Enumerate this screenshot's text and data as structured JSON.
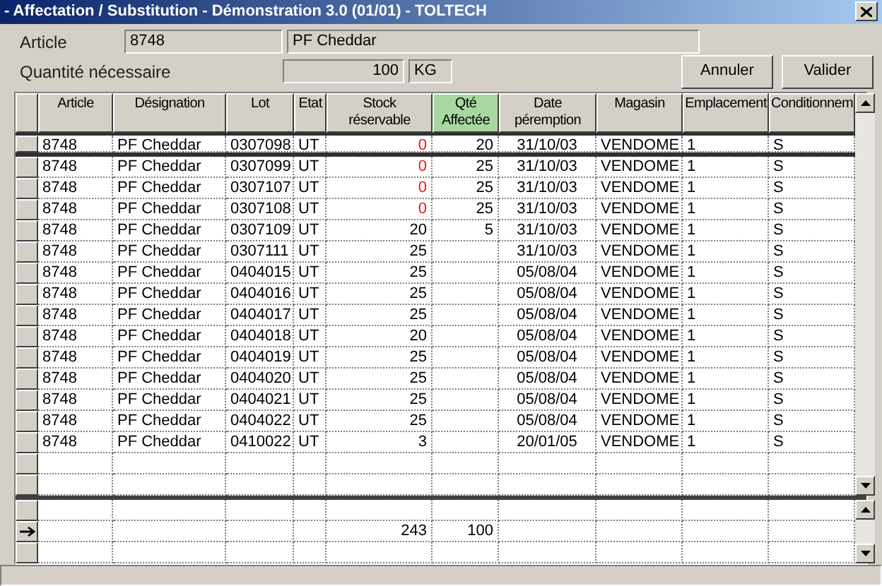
{
  "window": {
    "title": "- Affectation / Substitution - Démonstration 3.0 (01/01) - TOLTECH"
  },
  "article": {
    "label": "Article",
    "code": "8748",
    "name": "PF Cheddar"
  },
  "quantity": {
    "label": "Quantité nécessaire",
    "value": "100",
    "unit": "KG"
  },
  "buttons": [
    "Annuler",
    "Valider"
  ],
  "table": {
    "columns": [
      {
        "label": "Article",
        "highlighted": false
      },
      {
        "label": "Désignation",
        "highlighted": false
      },
      {
        "label": "Lot",
        "highlighted": false
      },
      {
        "label": "Etat",
        "highlighted": false
      },
      {
        "label": "Stock réservable",
        "highlighted": false
      },
      {
        "label": "Qté Affectée",
        "highlighted": true
      },
      {
        "label": "Date péremption",
        "highlighted": false
      },
      {
        "label": "Magasin",
        "highlighted": false
      },
      {
        "label": "Emplacement",
        "highlighted": false
      },
      {
        "label": "Conditionnem",
        "highlighted": false
      }
    ],
    "rows": [
      {
        "selected": true,
        "stock_alert": true,
        "cells": [
          "8748",
          "PF Cheddar",
          "0307098",
          "UT",
          "0",
          "20",
          "31/10/03",
          "VENDOME",
          "1",
          "S"
        ]
      },
      {
        "selected": false,
        "stock_alert": true,
        "cells": [
          "8748",
          "PF Cheddar",
          "0307099",
          "UT",
          "0",
          "25",
          "31/10/03",
          "VENDOME",
          "1",
          "S"
        ]
      },
      {
        "selected": false,
        "stock_alert": true,
        "cells": [
          "8748",
          "PF Cheddar",
          "0307107",
          "UT",
          "0",
          "25",
          "31/10/03",
          "VENDOME",
          "1",
          "S"
        ]
      },
      {
        "selected": false,
        "stock_alert": true,
        "cells": [
          "8748",
          "PF Cheddar",
          "0307108",
          "UT",
          "0",
          "25",
          "31/10/03",
          "VENDOME",
          "1",
          "S"
        ]
      },
      {
        "selected": false,
        "stock_alert": false,
        "cells": [
          "8748",
          "PF Cheddar",
          "0307109",
          "UT",
          "20",
          "5",
          "31/10/03",
          "VENDOME",
          "1",
          "S"
        ]
      },
      {
        "selected": false,
        "stock_alert": false,
        "cells": [
          "8748",
          "PF Cheddar",
          "0307111",
          "UT",
          "25",
          "",
          "31/10/03",
          "VENDOME",
          "1",
          "S"
        ]
      },
      {
        "selected": false,
        "stock_alert": false,
        "cells": [
          "8748",
          "PF Cheddar",
          "0404015",
          "UT",
          "25",
          "",
          "05/08/04",
          "VENDOME",
          "1",
          "S"
        ]
      },
      {
        "selected": false,
        "stock_alert": false,
        "cells": [
          "8748",
          "PF Cheddar",
          "0404016",
          "UT",
          "25",
          "",
          "05/08/04",
          "VENDOME",
          "1",
          "S"
        ]
      },
      {
        "selected": false,
        "stock_alert": false,
        "cells": [
          "8748",
          "PF Cheddar",
          "0404017",
          "UT",
          "25",
          "",
          "05/08/04",
          "VENDOME",
          "1",
          "S"
        ]
      },
      {
        "selected": false,
        "stock_alert": false,
        "cells": [
          "8748",
          "PF Cheddar",
          "0404018",
          "UT",
          "20",
          "",
          "05/08/04",
          "VENDOME",
          "1",
          "S"
        ]
      },
      {
        "selected": false,
        "stock_alert": false,
        "cells": [
          "8748",
          "PF Cheddar",
          "0404019",
          "UT",
          "25",
          "",
          "05/08/04",
          "VENDOME",
          "1",
          "S"
        ]
      },
      {
        "selected": false,
        "stock_alert": false,
        "cells": [
          "8748",
          "PF Cheddar",
          "0404020",
          "UT",
          "25",
          "",
          "05/08/04",
          "VENDOME",
          "1",
          "S"
        ]
      },
      {
        "selected": false,
        "stock_alert": false,
        "cells": [
          "8748",
          "PF Cheddar",
          "0404021",
          "UT",
          "25",
          "",
          "05/08/04",
          "VENDOME",
          "1",
          "S"
        ]
      },
      {
        "selected": false,
        "stock_alert": false,
        "cells": [
          "8748",
          "PF Cheddar",
          "0404022",
          "UT",
          "25",
          "",
          "05/08/04",
          "VENDOME",
          "1",
          "S"
        ]
      },
      {
        "selected": false,
        "stock_alert": false,
        "cells": [
          "8748",
          "PF Cheddar",
          "0410022",
          "UT",
          "3",
          "",
          "20/01/05",
          "VENDOME",
          "1",
          "S"
        ]
      }
    ],
    "footer_rows": [
      {
        "current": false,
        "cells": [
          "",
          "",
          "",
          "",
          "",
          "",
          "",
          "",
          "",
          ""
        ]
      },
      {
        "current": true,
        "cells": [
          "",
          "",
          "",
          "",
          "243",
          "100",
          "",
          "",
          "",
          ""
        ]
      },
      {
        "current": false,
        "cells": [
          "",
          "",
          "",
          "",
          "",
          "",
          "",
          "",
          "",
          ""
        ]
      }
    ]
  }
}
